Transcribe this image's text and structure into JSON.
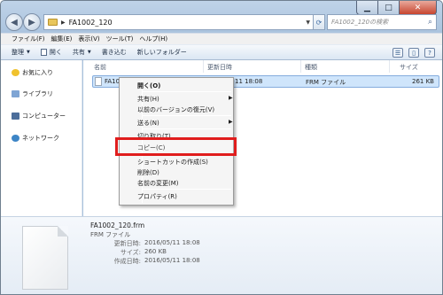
{
  "window": {
    "address_path": "FA1002_120",
    "search_placeholder": "FA1002_120の検索"
  },
  "menubar": [
    "ファイル(F)",
    "編集(E)",
    "表示(V)",
    "ツール(T)",
    "ヘルプ(H)"
  ],
  "toolbar": {
    "organize": "整理",
    "open": "開く",
    "share": "共有",
    "burn": "書き込む",
    "new_folder": "新しいフォルダー"
  },
  "navpane": {
    "favorites": "お気に入り",
    "libraries": "ライブラリ",
    "computer": "コンピューター",
    "network": "ネットワーク"
  },
  "columns": {
    "name": "名前",
    "modified": "更新日時",
    "type": "種類",
    "size": "サイズ"
  },
  "file": {
    "name_partial": "FA100",
    "modified_partial": "11 18:08",
    "type": "FRM ファイル",
    "size": "261 KB"
  },
  "context_menu": {
    "open": "開く(O)",
    "share": "共有(H)",
    "restore": "以前のバージョンの復元(V)",
    "send_to": "送る(N)",
    "cut": "切り取り(T)",
    "copy": "コピー(C)",
    "shortcut": "ショートカットの作成(S)",
    "delete": "削除(D)",
    "rename": "名前の変更(M)",
    "properties": "プロパティ(R)",
    "highlighted": "コピー(C)"
  },
  "details": {
    "filename": "FA1002_120.frm",
    "filetype": "FRM ファイル",
    "modified_label": "更新日時:",
    "modified_value": "2016/05/11 18:08",
    "size_label": "サイズ:",
    "size_value": "260 KB",
    "created_label": "作成日時:",
    "created_value": "2016/05/11 18:08"
  },
  "colors": {
    "highlight_box": "#e01d1d",
    "selection": "#cfe5fb"
  }
}
